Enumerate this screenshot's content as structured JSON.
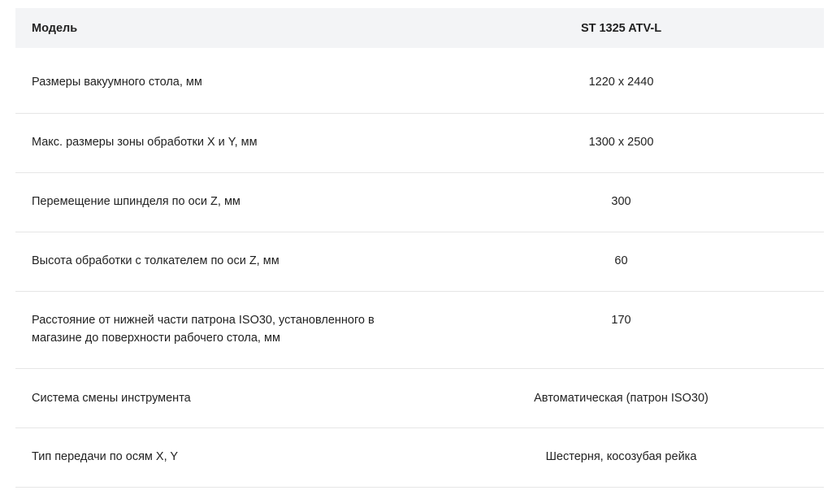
{
  "table": {
    "header": {
      "label": "Модель",
      "value": "ST 1325 ATV-L"
    },
    "rows": [
      {
        "label": "Размеры вакуумного стола, мм",
        "value": "1220 х 2440"
      },
      {
        "label": "Макс. размеры зоны обработки X и Y, мм",
        "value": "1300 х 2500"
      },
      {
        "label": "Перемещение шпинделя по оси Z, мм",
        "value": "300"
      },
      {
        "label": "Высота обработки с толкателем по оси Z, мм",
        "value": "60"
      },
      {
        "label": "Расстояние от нижней части патрона ISO30, установленного в магазине до поверхности рабочего стола, мм",
        "value": "170"
      },
      {
        "label": "Система смены инструмента",
        "value": "Автоматическая (патрон ISO30)"
      },
      {
        "label": "Тип передачи по осям X, Y",
        "value": "Шестерня, косозубая рейка"
      }
    ]
  }
}
